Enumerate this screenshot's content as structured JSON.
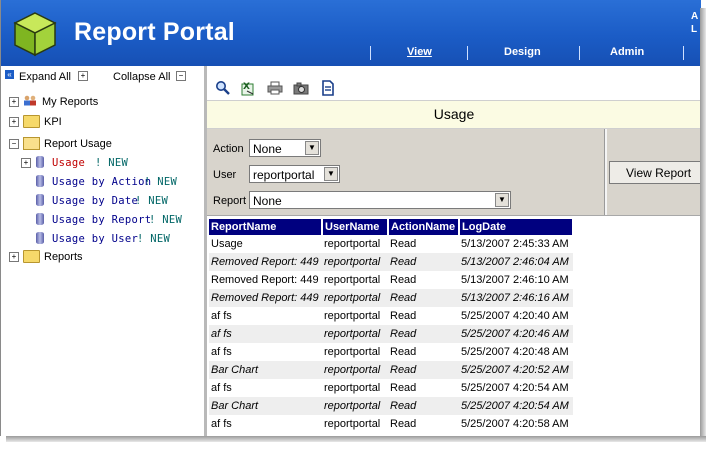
{
  "header": {
    "app_title": "Report Portal",
    "user_line1": "A",
    "user_line2": "L",
    "tabs": [
      {
        "label": "View"
      },
      {
        "label": "Design"
      },
      {
        "label": "Admin"
      }
    ]
  },
  "tree": {
    "expand_all": "Expand All",
    "collapse_all": "Collapse All",
    "items": [
      {
        "label": "My Reports"
      },
      {
        "label": "KPI"
      },
      {
        "label": "Report Usage"
      },
      {
        "label": "Usage",
        "badge": "! NEW"
      },
      {
        "label": "Usage by Action",
        "badge": "! NEW"
      },
      {
        "label": "Usage by Date",
        "badge": "! NEW"
      },
      {
        "label": "Usage by Report",
        "badge": "! NEW"
      },
      {
        "label": "Usage by User",
        "badge": "! NEW"
      },
      {
        "label": "Reports"
      }
    ]
  },
  "main": {
    "title": "Usage",
    "filters": {
      "action_label": "Action",
      "action_value": "None",
      "user_label": "User",
      "user_value": "reportportal",
      "report_label": "Report",
      "report_value": "None"
    },
    "view_button": "View Report",
    "table": {
      "headers": [
        "ReportName",
        "UserName",
        "ActionName",
        "LogDate"
      ],
      "rows": [
        [
          "Usage",
          "reportportal",
          "Read",
          "5/13/2007 2:45:33 AM"
        ],
        [
          "Removed Report: 449",
          "reportportal",
          "Read",
          "5/13/2007 2:46:04 AM"
        ],
        [
          "Removed Report: 449",
          "reportportal",
          "Read",
          "5/13/2007 2:46:10 AM"
        ],
        [
          "Removed Report: 449",
          "reportportal",
          "Read",
          "5/13/2007 2:46:16 AM"
        ],
        [
          "af fs",
          "reportportal",
          "Read",
          "5/25/2007 4:20:40 AM"
        ],
        [
          "af fs",
          "reportportal",
          "Read",
          "5/25/2007 4:20:46 AM"
        ],
        [
          "af fs",
          "reportportal",
          "Read",
          "5/25/2007 4:20:48 AM"
        ],
        [
          "Bar Chart",
          "reportportal",
          "Read",
          "5/25/2007 4:20:52 AM"
        ],
        [
          "af fs",
          "reportportal",
          "Read",
          "5/25/2007 4:20:54 AM"
        ],
        [
          "Bar Chart",
          "reportportal",
          "Read",
          "5/25/2007 4:20:54 AM"
        ],
        [
          "af fs",
          "reportportal",
          "Read",
          "5/25/2007 4:20:58 AM"
        ]
      ]
    }
  },
  "colors": {
    "header_blue": "#1b5cc6",
    "grid_header": "#00007f",
    "title_bar": "#fbfbe3",
    "new_badge": "#006666",
    "selected_item": "#c00000"
  }
}
